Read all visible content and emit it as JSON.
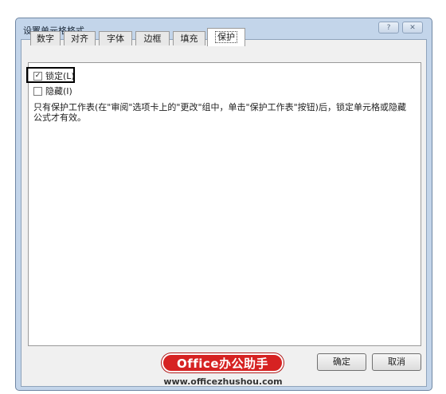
{
  "dialog": {
    "title": "设置单元格格式",
    "help_glyph": "?",
    "close_glyph": "✕"
  },
  "tabs": [
    {
      "label": "数字",
      "active": false
    },
    {
      "label": "对齐",
      "active": false
    },
    {
      "label": "字体",
      "active": false
    },
    {
      "label": "边框",
      "active": false
    },
    {
      "label": "填充",
      "active": false
    },
    {
      "label": "保护",
      "active": true
    }
  ],
  "protection": {
    "locked": {
      "label": "锁定(L)",
      "checked": true
    },
    "hidden": {
      "label": "隐藏(I)",
      "checked": false
    },
    "description": "只有保护工作表(在\"审阅\"选项卡上的\"更改\"组中，单击\"保护工作表\"按钮)后，锁定单元格或隐藏公式才有效。"
  },
  "buttons": {
    "ok": "确定",
    "cancel": "取消"
  },
  "watermark": {
    "brand": "Office办公助手",
    "url": "www.officezhushou.com"
  }
}
